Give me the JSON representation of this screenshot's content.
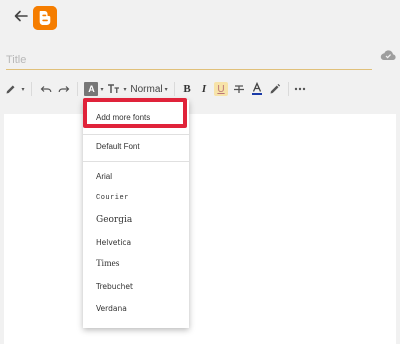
{
  "header": {
    "back_icon": "arrow-left-icon",
    "logo_icon": "blogger-logo-icon",
    "brand_color": "#f57d00"
  },
  "title_field": {
    "placeholder": "Title",
    "value": "",
    "underline_color": "#e0c07a"
  },
  "cloud_icon": "cloud-sync-icon",
  "toolbar": {
    "pen_icon": "pencil-icon",
    "undo_icon": "undo-icon",
    "redo_icon": "redo-icon",
    "font_icon": "font-family-icon",
    "font_icon_letter": "A",
    "font_size_icon": "text-size-icon",
    "heading_label": "Normal",
    "bold_label": "B",
    "italic_label": "I",
    "underline_label": "U",
    "strikethrough_icon": "strikethrough-icon",
    "text_color_icon": "text-color-icon",
    "text_color_letter": "A",
    "highlight_icon": "highlighter-icon",
    "more_icon": "more-horizontal-icon"
  },
  "font_menu": {
    "add_more_label": "Add more fonts",
    "default_label": "Default Font",
    "fonts": [
      {
        "label": "Arial"
      },
      {
        "label": "Courier"
      },
      {
        "label": "Georgia"
      },
      {
        "label": "Helvetica"
      },
      {
        "label": "Times"
      },
      {
        "label": "Trebuchet"
      },
      {
        "label": "Verdana"
      }
    ],
    "highlight_color": "#e0233a"
  }
}
